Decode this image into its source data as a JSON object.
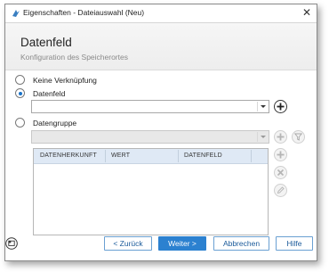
{
  "window": {
    "title": "Eigenschaften - Dateiauswahl (Neu)",
    "close_glyph": "✕"
  },
  "header": {
    "title": "Datenfeld",
    "subtitle": "Konfiguration des Speicherortes"
  },
  "options": {
    "none_label": "Keine Verknüpfung",
    "datafield_label": "Datenfeld",
    "datagroup_label": "Datengruppe",
    "selected": "datafield"
  },
  "datafield_combo": {
    "value": ""
  },
  "datagroup_combo": {
    "value": ""
  },
  "table": {
    "columns": [
      "DATENHERKUNFT",
      "WERT",
      "DATENFELD"
    ],
    "rows": []
  },
  "buttons": {
    "back": "< Zurück",
    "next": "Weiter >",
    "cancel": "Abbrechen",
    "help": "Hilfe"
  },
  "colors": {
    "accent": "#2c81d0",
    "header_bg": "#efefef",
    "table_header_bg": "#dfe9f5"
  }
}
